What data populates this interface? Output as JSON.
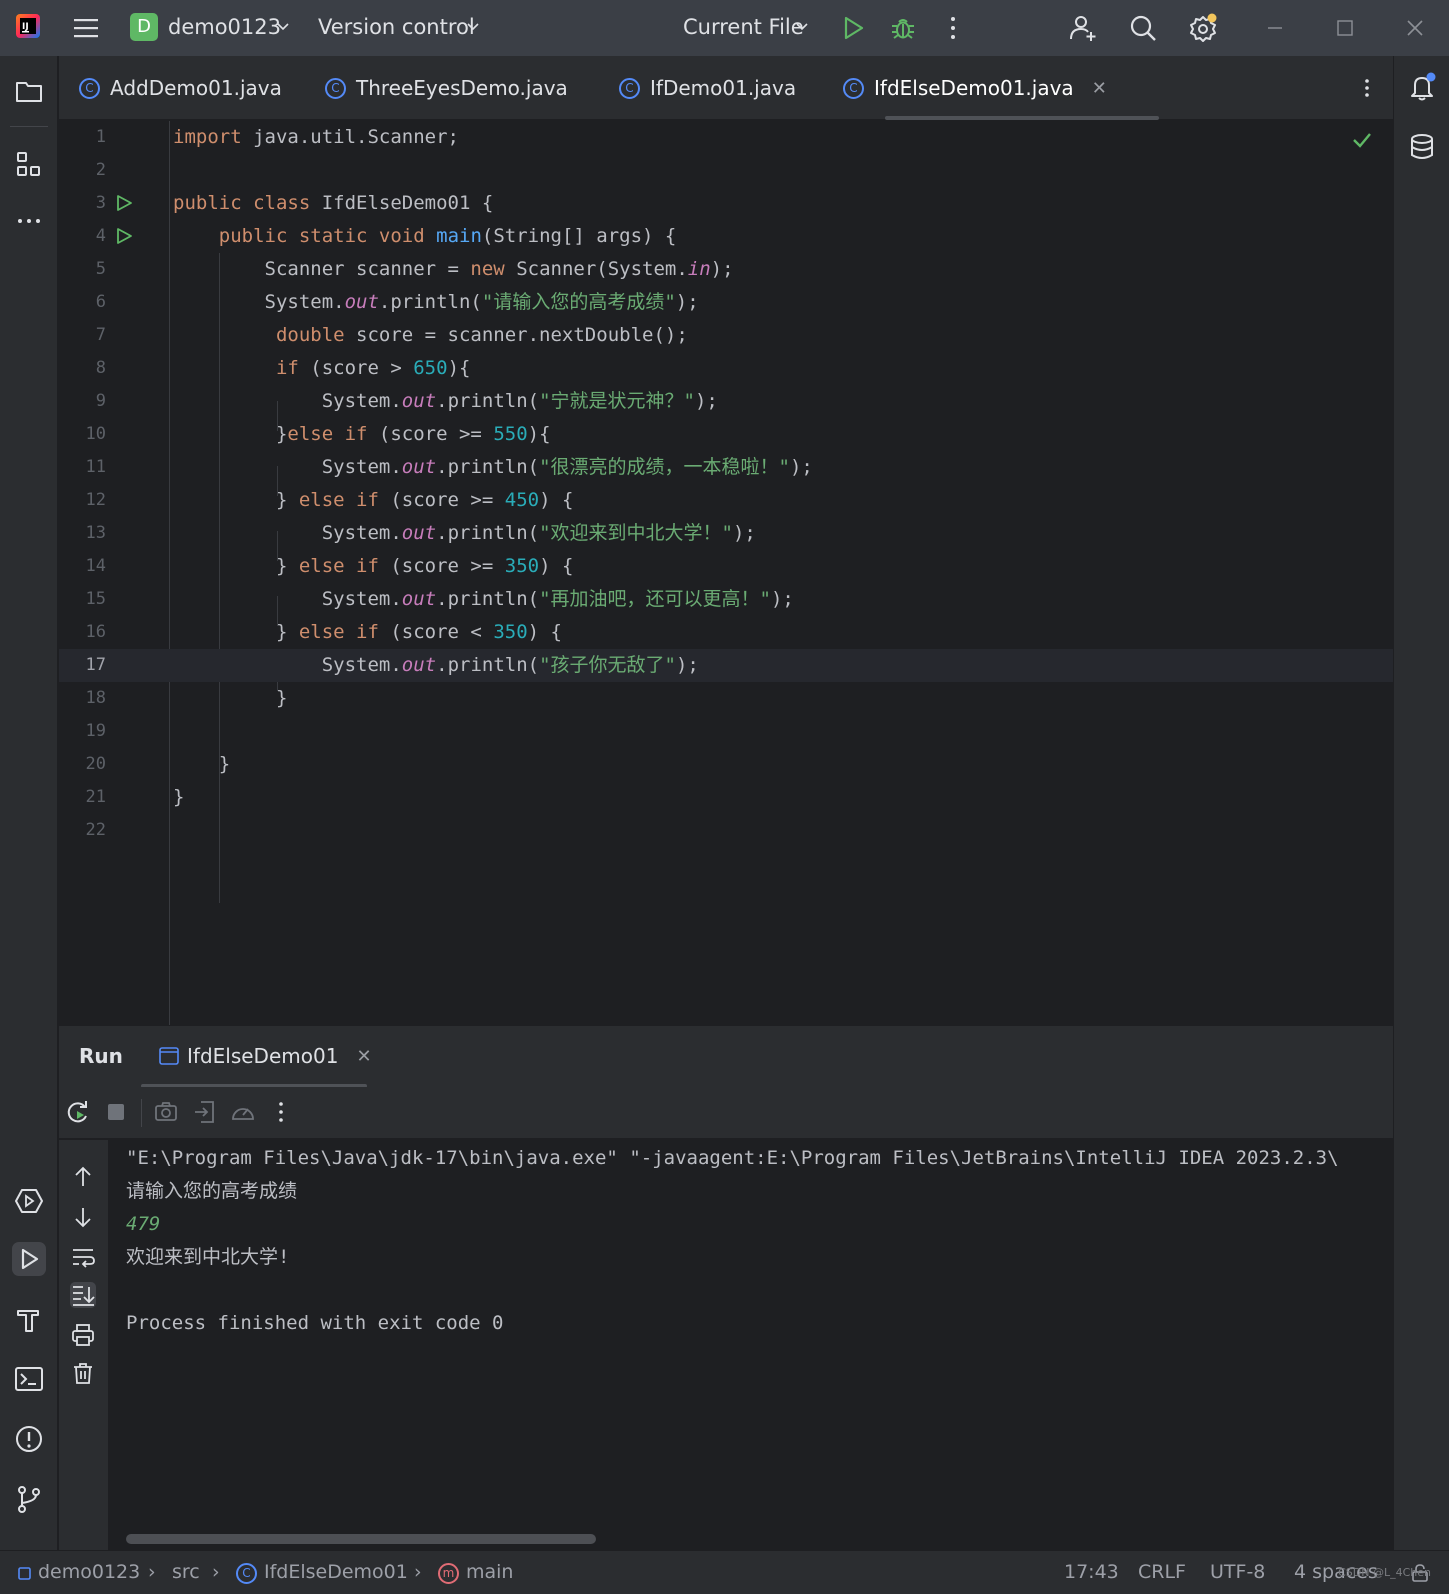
{
  "titlebar": {
    "project_badge": "D",
    "project_name": "demo0123",
    "version_control": "Version control",
    "run_config": "Current File"
  },
  "tabs": [
    {
      "label": "AddDemo01.java",
      "active": false
    },
    {
      "label": "ThreeEyesDemo.java",
      "active": false
    },
    {
      "label": "IfDemo01.java",
      "active": false
    },
    {
      "label": "IfdElseDemo01.java",
      "active": true
    }
  ],
  "editor": {
    "current_line": 17,
    "line_numbers": [
      "1",
      "2",
      "3",
      "4",
      "5",
      "6",
      "7",
      "8",
      "9",
      "10",
      "11",
      "12",
      "13",
      "14",
      "15",
      "16",
      "17",
      "18",
      "19",
      "20",
      "21",
      "22"
    ],
    "status": "no-problems"
  },
  "code": {
    "l1_kw": "import",
    "l1_rest": " java.util.Scanner;",
    "l3_kw": "public class",
    "l3_rest": " IfdElseDemo01 {",
    "l4_kw": "public static void",
    "l4_fn": "main",
    "l4_rest": "(String[] args) {",
    "l5_a": "Scanner scanner = ",
    "l5_kw": "new",
    "l5_b": " Scanner(System.",
    "l5_fld": "in",
    "l5_c": ");",
    "sys": "System.",
    "out": "out",
    "println": ".println(",
    "end": ");",
    "l6_str": "\"请输入您的高考成绩\"",
    "l7_kw": "double",
    "l7_rest": " score = scanner.nextDouble();",
    "if_kw": "if",
    "l8_a": " (score > ",
    "l8_num": "650",
    "l8_b": "){",
    "l9_str": "\"宁就是状元神？\"",
    "l10_a": "}",
    "else_if": "else if",
    "l10_b": " (score >= ",
    "l10_num": "550",
    "l10_c": "){",
    "l11_str": "\"很漂亮的成绩，一本稳啦！\"",
    "l12_a": "} ",
    "l12_b": " (score >= ",
    "l12_num": "450",
    "l12_c": ") {",
    "l13_str": "\"欢迎来到中北大学！\"",
    "l14_num": "350",
    "l15_str": "\"再加油吧，还可以更高！\"",
    "l16_b": " (score < ",
    "l16_num": "350",
    "l17_str": "\"孩子你无敌了\"",
    "close_brace": "}"
  },
  "run_panel": {
    "title": "Run",
    "tab_label": "IfdElseDemo01",
    "console": [
      "\"E:\\Program Files\\Java\\jdk-17\\bin\\java.exe\" \"-javaagent:E:\\Program Files\\JetBrains\\IntelliJ IDEA 2023.2.3\\",
      "请输入您的高考成绩",
      "479",
      "欢迎来到中北大学!",
      "",
      "Process finished with exit code 0"
    ]
  },
  "statusbar": {
    "crumb_project": "demo0123",
    "crumb_src": "src",
    "crumb_class": "IfdElseDemo01",
    "crumb_method": "main",
    "position": "17:43",
    "line_sep": "CRLF",
    "encoding": "UTF-8",
    "indent": "4 spaces"
  },
  "watermark": "CSDN @L_4Chen",
  "colors": {
    "keyword": "#cf8e6d",
    "function": "#56a8f5",
    "number": "#2aacb8",
    "string": "#6aab73",
    "field": "#c77dbb",
    "accent": "#548af7",
    "run_green": "#5fb865"
  }
}
